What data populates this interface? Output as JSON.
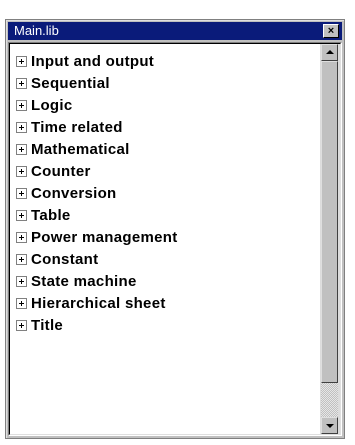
{
  "window": {
    "title": "Main.lib",
    "close_label": "×"
  },
  "tree": {
    "items": [
      {
        "label": "Input and output"
      },
      {
        "label": "Sequential"
      },
      {
        "label": "Logic"
      },
      {
        "label": "Time related"
      },
      {
        "label": "Mathematical"
      },
      {
        "label": "Counter"
      },
      {
        "label": "Conversion"
      },
      {
        "label": "Table"
      },
      {
        "label": "Power management"
      },
      {
        "label": "Constant"
      },
      {
        "label": "State machine"
      },
      {
        "label": "Hierarchical sheet"
      },
      {
        "label": "Title"
      }
    ]
  },
  "icons": {
    "expander": "plus-box-icon",
    "scroll_up": "arrow-up-icon",
    "scroll_down": "arrow-down-icon",
    "close": "close-icon"
  },
  "colors": {
    "titlebar": "#0a1b7a",
    "title_text": "#ffffff",
    "chrome": "#c0c0c0"
  }
}
